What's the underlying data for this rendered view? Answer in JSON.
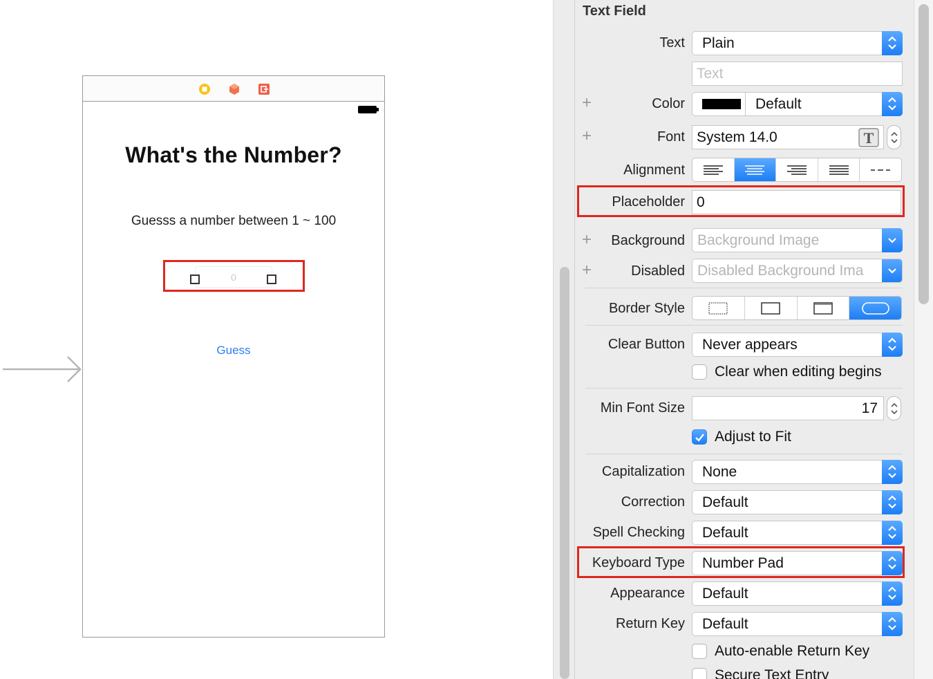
{
  "canvas": {
    "scene": {
      "title": "What's the Number?",
      "subtitle": "Guesss a number between 1 ~ 100",
      "text_field_placeholder": "0",
      "guess_button": "Guess"
    }
  },
  "inspector": {
    "section_title": "Text Field",
    "text": {
      "label": "Text",
      "value": "Plain",
      "content_placeholder": "Text"
    },
    "color": {
      "label": "Color",
      "value": "Default",
      "swatch": "#000000"
    },
    "font": {
      "label": "Font",
      "value": "System 14.0"
    },
    "alignment": {
      "label": "Alignment",
      "options": [
        "left",
        "center",
        "right",
        "justified",
        "natural"
      ],
      "selected": "center"
    },
    "placeholder": {
      "label": "Placeholder",
      "value": "0"
    },
    "background": {
      "label": "Background",
      "placeholder": "Background Image"
    },
    "disabled": {
      "label": "Disabled",
      "placeholder": "Disabled Background Ima"
    },
    "border_style": {
      "label": "Border Style",
      "options": [
        "none",
        "line",
        "bezel",
        "rounded"
      ],
      "selected": "rounded"
    },
    "clear_button": {
      "label": "Clear Button",
      "value": "Never appears"
    },
    "clear_when_editing": {
      "label": "Clear when editing begins",
      "checked": false
    },
    "min_font_size": {
      "label": "Min Font Size",
      "value": "17"
    },
    "adjust_to_fit": {
      "label": "Adjust to Fit",
      "checked": true
    },
    "capitalization": {
      "label": "Capitalization",
      "value": "None"
    },
    "correction": {
      "label": "Correction",
      "value": "Default"
    },
    "spell_checking": {
      "label": "Spell Checking",
      "value": "Default"
    },
    "keyboard_type": {
      "label": "Keyboard Type",
      "value": "Number Pad"
    },
    "appearance": {
      "label": "Appearance",
      "value": "Default"
    },
    "return_key": {
      "label": "Return Key",
      "value": "Default"
    },
    "auto_enable_return": {
      "label": "Auto-enable Return Key",
      "checked": false
    },
    "secure_text": {
      "label": "Secure Text Entry",
      "checked": false
    }
  },
  "colors": {
    "accent": "#1d7ef5",
    "highlight": "#e0261f",
    "link": "#2c7ff0"
  }
}
